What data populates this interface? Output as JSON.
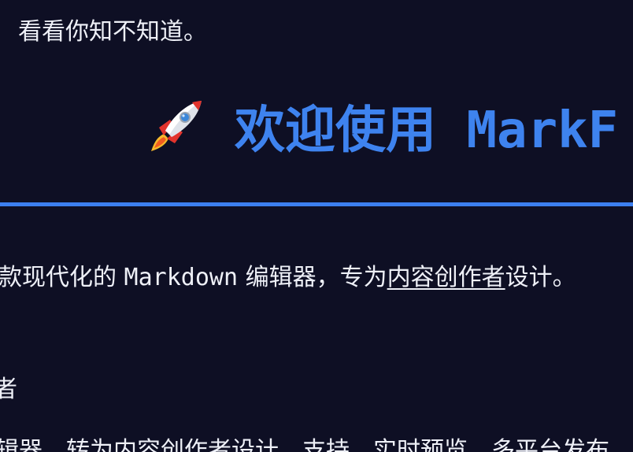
{
  "content": {
    "top_line": "看看你知不知道。",
    "heading": {
      "icon": "rocket-icon",
      "text": "欢迎使用 MarkF"
    },
    "intro": {
      "prefix": "款现代化的",
      "mono": "Markdown",
      "middle": "编辑器，专为",
      "link": "内容创作者",
      "suffix": "设计。"
    },
    "partial_line_2": "者",
    "partial_line_3": "辑器，转为内容创作者设计，支持，实时预览，多平台发布"
  },
  "colors": {
    "background": "#0e0f24",
    "heading": "#3e83ef",
    "rule": "#3c7ff0",
    "text": "#eef0f7"
  }
}
